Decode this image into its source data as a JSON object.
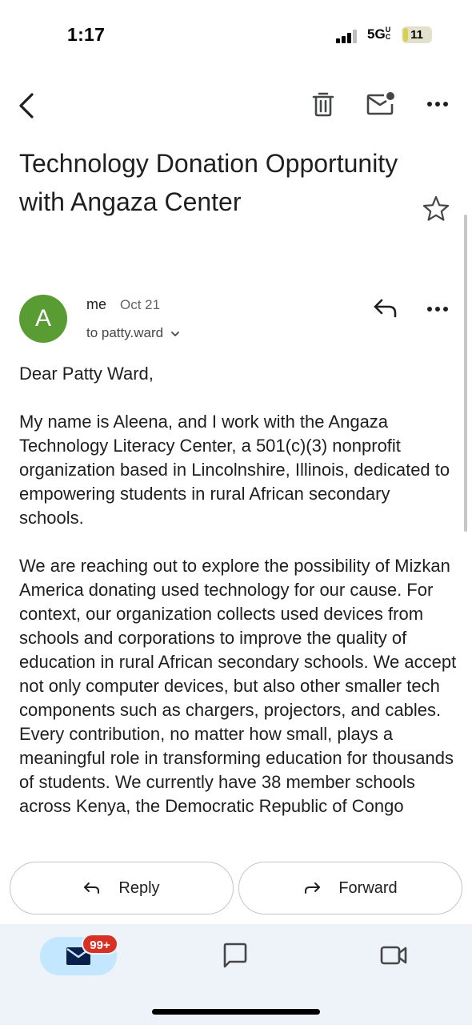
{
  "status_bar": {
    "time": "1:17",
    "network": "5G",
    "network_suffix": "UC",
    "battery": "11"
  },
  "toolbar": {
    "back_icon": "back-arrow-icon",
    "delete_icon": "trash-icon",
    "mark_unread_icon": "mail-unread-icon",
    "more_icon": "more-horizontal-icon"
  },
  "email": {
    "subject": "Technology Donation Opportunity with Angaza Center",
    "star_icon": "star-outline-icon",
    "sender": {
      "avatar_letter": "A",
      "avatar_color": "#5a9c34",
      "name": "me",
      "date": "Oct 21",
      "recipient": "to patty.ward"
    },
    "body": [
      "Dear Patty Ward,",
      "My name is Aleena, and I work with the Angaza Technology Literacy Center, a 501(c)(3) nonprofit organization based in Lincolnshire, Illinois, dedicated to empowering students in rural African secondary schools.",
      "We are reaching out to explore the possibility of Mizkan America donating used technology for our cause. For context, our organization collects used devices from schools and corporations to improve the quality of education in rural African secondary schools. We accept not only computer devices, but also other smaller tech components such as chargers, projectors, and cables. Every contribution, no matter how small, plays a meaningful role in transforming education for thousands of students. We currently have 38 member schools across Kenya, the Democratic Republic of Congo"
    ]
  },
  "actions": {
    "reply_label": "Reply",
    "forward_label": "Forward"
  },
  "bottom_nav": {
    "mail_badge": "99+",
    "mail_icon": "mail-icon",
    "chat_icon": "chat-icon",
    "meet_icon": "video-icon",
    "active_color": "#c2e7ff",
    "badge_color": "#d93025"
  }
}
